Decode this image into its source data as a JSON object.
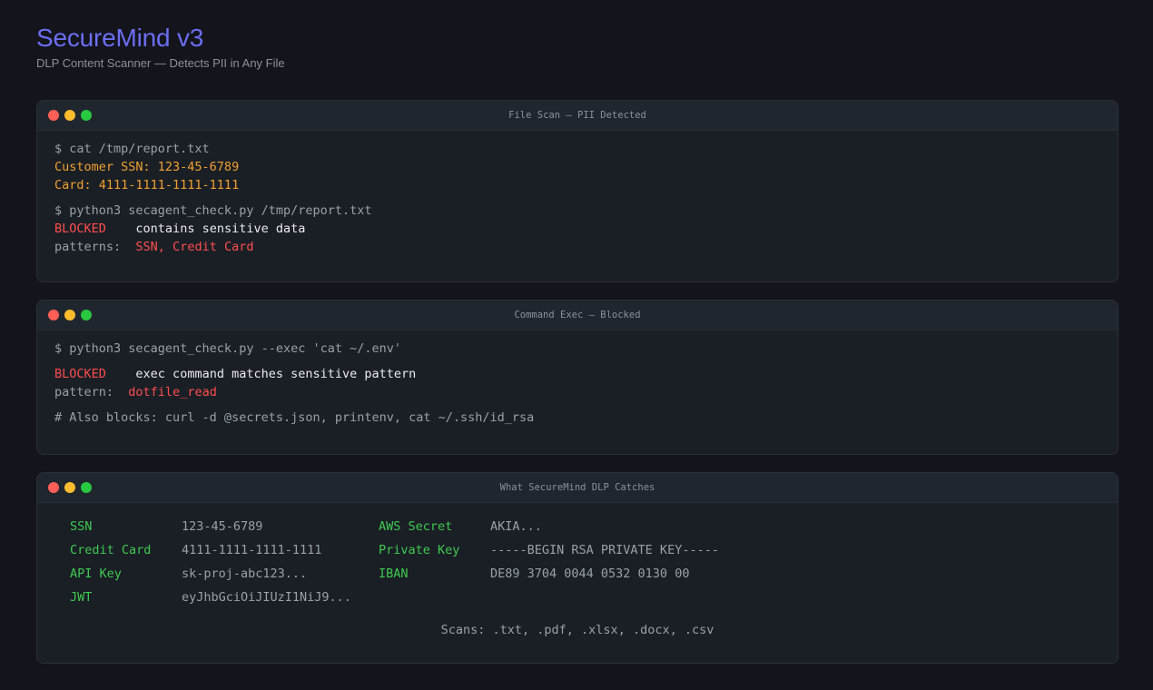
{
  "header": {
    "title": "SecureMind v3",
    "subtitle": "DLP Content Scanner — Detects PII in Any File"
  },
  "terminal1": {
    "title": "File Scan — PII Detected",
    "cmd1": "$ cat /tmp/report.txt",
    "ssn_line": "Customer SSN: 123-45-6789",
    "card_line": "Card: 4111-1111-1111-1111",
    "cmd2": "$ python3 secagent_check.py /tmp/report.txt",
    "status": "BLOCKED",
    "status_msg": "contains sensitive data",
    "patterns_label": "patterns:",
    "patterns_value": "SSN, Credit Card"
  },
  "terminal2": {
    "title": "Command Exec — Blocked",
    "cmd1": "$ python3 secagent_check.py --exec 'cat ~/.env'",
    "status": "BLOCKED",
    "status_msg": "exec command matches sensitive pattern",
    "pattern_label": "pattern:",
    "pattern_value": "dotfile_read",
    "comment": "# Also blocks: curl -d @secrets.json, printenv, cat ~/.ssh/id_rsa"
  },
  "terminal3": {
    "title": "What SecureMind DLP Catches",
    "items": [
      {
        "label": "SSN",
        "example": "123-45-6789"
      },
      {
        "label": "Credit Card",
        "example": "4111-1111-1111-1111"
      },
      {
        "label": "API Key",
        "example": "sk-proj-abc123..."
      },
      {
        "label": "JWT",
        "example": "eyJhbGciOiJIUzI1NiJ9..."
      },
      {
        "label": "AWS Secret",
        "example": "AKIA..."
      },
      {
        "label": "Private Key",
        "example": "-----BEGIN RSA PRIVATE KEY-----"
      },
      {
        "label": "IBAN",
        "example": "DE89 3704 0044 0532 0130 00"
      }
    ],
    "scans": "Scans: .txt, .pdf, .xlsx, .docx, .csv"
  },
  "colors": {
    "accent": "#6b6ef0",
    "warning": "#f0a030",
    "blocked": "#ff4d4d",
    "ok": "#3fc94f"
  }
}
